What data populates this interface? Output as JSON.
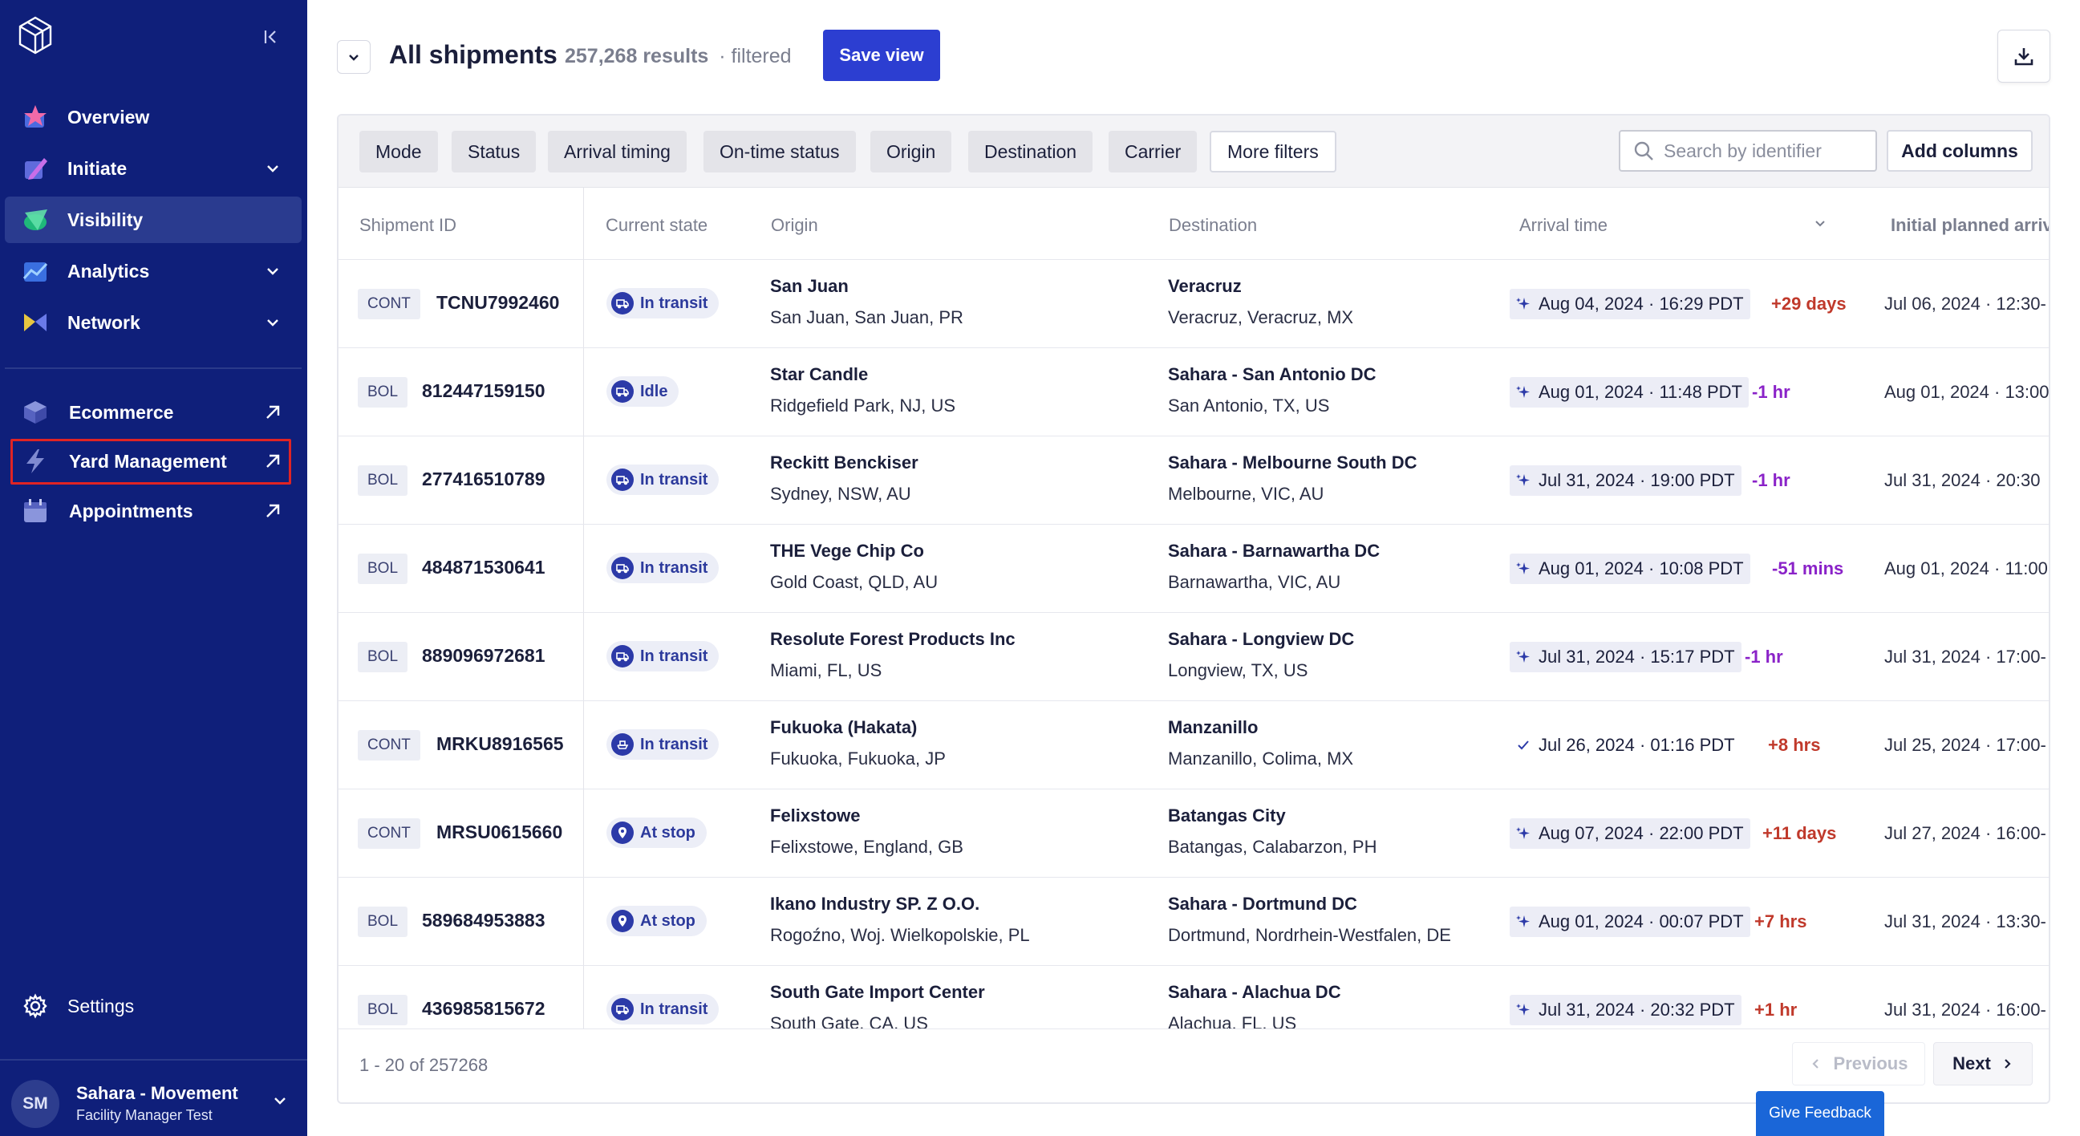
{
  "sidebar": {
    "items": [
      {
        "label": "Overview",
        "icon": "overview-icon"
      },
      {
        "label": "Initiate",
        "icon": "initiate-icon"
      },
      {
        "label": "Visibility",
        "icon": "visibility-icon"
      },
      {
        "label": "Analytics",
        "icon": "analytics-icon"
      },
      {
        "label": "Network",
        "icon": "network-icon"
      }
    ],
    "external_items": [
      {
        "label": "Ecommerce",
        "icon": "ecommerce-icon"
      },
      {
        "label": "Yard Management",
        "icon": "lightning-icon"
      },
      {
        "label": "Appointments",
        "icon": "calendar-icon"
      }
    ],
    "settings_label": "Settings",
    "user": {
      "initials": "SM",
      "name": "Sahara - Movement",
      "role": "Facility Manager Test"
    }
  },
  "header": {
    "title": "All shipments",
    "results_count": "257,268 results",
    "filtered_label": "· filtered",
    "save_view_label": "Save view"
  },
  "filters": {
    "chips": [
      "Mode",
      "Status",
      "Arrival timing",
      "On-time status",
      "Origin",
      "Destination",
      "Carrier"
    ],
    "more_filters": "More filters",
    "search_placeholder": "Search by identifier",
    "add_columns": "Add columns"
  },
  "table": {
    "columns": [
      "Shipment ID",
      "Current state",
      "Origin",
      "Destination",
      "Arrival time",
      "Initial planned arriv"
    ],
    "rows": [
      {
        "type": "CONT",
        "id": "TCNU7992460",
        "state": "In transit",
        "state_icon": "truck-icon",
        "origin_name": "San Juan",
        "origin_loc": "San Juan, San Juan, PR",
        "dest_name": "Veracruz",
        "dest_loc": "Veracruz, Veracruz, MX",
        "arrival": "Aug 04, 2024 · 16:29 PDT",
        "arrival_icon": "sparkle-icon",
        "delta": "+29 days",
        "delta_color": "#c0392b",
        "planned": "Jul 06, 2024 · 12:30-"
      },
      {
        "type": "BOL",
        "id": "812447159150",
        "state": "Idle",
        "state_icon": "truck-icon",
        "origin_name": "Star Candle",
        "origin_loc": "Ridgefield Park, NJ, US",
        "dest_name": "Sahara - San Antonio DC",
        "dest_loc": "San Antonio, TX, US",
        "arrival": "Aug 01, 2024 · 11:48 PDT",
        "arrival_icon": "sparkle-icon",
        "delta": "-1 hr",
        "delta_color": "#8a22c8",
        "planned": "Aug 01, 2024 · 13:00"
      },
      {
        "type": "BOL",
        "id": "277416510789",
        "state": "In transit",
        "state_icon": "truck-icon",
        "origin_name": "Reckitt Benckiser",
        "origin_loc": "Sydney, NSW, AU",
        "dest_name": "Sahara - Melbourne South DC",
        "dest_loc": "Melbourne, VIC, AU",
        "arrival": "Jul 31, 2024 · 19:00 PDT",
        "arrival_icon": "sparkle-icon",
        "delta": "-1 hr",
        "delta_color": "#8a22c8",
        "planned": "Jul 31, 2024 · 20:30"
      },
      {
        "type": "BOL",
        "id": "484871530641",
        "state": "In transit",
        "state_icon": "truck-icon",
        "origin_name": "THE Vege Chip Co",
        "origin_loc": "Gold Coast, QLD, AU",
        "dest_name": "Sahara - Barnawartha DC",
        "dest_loc": "Barnawartha, VIC, AU",
        "arrival": "Aug 01, 2024 · 10:08 PDT",
        "arrival_icon": "sparkle-icon",
        "delta": "-51 mins",
        "delta_color": "#8a22c8",
        "planned": "Aug 01, 2024 · 11:00"
      },
      {
        "type": "BOL",
        "id": "889096972681",
        "state": "In transit",
        "state_icon": "truck-icon",
        "origin_name": "Resolute Forest Products Inc",
        "origin_loc": "Miami, FL, US",
        "dest_name": "Sahara - Longview DC",
        "dest_loc": "Longview, TX, US",
        "arrival": "Jul 31, 2024 · 15:17 PDT",
        "arrival_icon": "sparkle-icon",
        "delta": "-1 hr",
        "delta_color": "#8a22c8",
        "planned": "Jul 31, 2024 · 17:00-"
      },
      {
        "type": "CONT",
        "id": "MRKU8916565",
        "state": "In transit",
        "state_icon": "ship-icon",
        "origin_name": "Fukuoka (Hakata)",
        "origin_loc": "Fukuoka, Fukuoka, JP",
        "dest_name": "Manzanillo",
        "dest_loc": "Manzanillo, Colima, MX",
        "arrival": "Jul 26, 2024 · 01:16 PDT",
        "arrival_icon": "check-icon",
        "delta": "+8 hrs",
        "delta_color": "#c0392b",
        "planned": "Jul 25, 2024 · 17:00-"
      },
      {
        "type": "CONT",
        "id": "MRSU0615660",
        "state": "At stop",
        "state_icon": "pin-icon",
        "origin_name": "Felixstowe",
        "origin_loc": "Felixstowe, England, GB",
        "dest_name": "Batangas City",
        "dest_loc": "Batangas, Calabarzon, PH",
        "arrival": "Aug 07, 2024 · 22:00 PDT",
        "arrival_icon": "sparkle-icon",
        "delta": "+11 days",
        "delta_color": "#c0392b",
        "planned": "Jul 27, 2024 · 16:00-"
      },
      {
        "type": "BOL",
        "id": "589684953883",
        "state": "At stop",
        "state_icon": "pin-icon",
        "origin_name": "Ikano Industry SP. Z O.O.",
        "origin_loc": "Rogoźno, Woj. Wielkopolskie, PL",
        "dest_name": "Sahara - Dortmund DC",
        "dest_loc": "Dortmund, Nordrhein-Westfalen, DE",
        "arrival": "Aug 01, 2024 · 00:07 PDT",
        "arrival_icon": "sparkle-icon",
        "delta": "+7 hrs",
        "delta_color": "#c0392b",
        "planned": "Jul 31, 2024 · 13:30-"
      },
      {
        "type": "BOL",
        "id": "436985815672",
        "state": "In transit",
        "state_icon": "truck-icon",
        "origin_name": "South Gate Import Center",
        "origin_loc": "South Gate, CA, US",
        "dest_name": "Sahara - Alachua DC",
        "dest_loc": "Alachua, FL, US",
        "arrival": "Jul 31, 2024 · 20:32 PDT",
        "arrival_icon": "sparkle-icon",
        "delta": "+1 hr",
        "delta_color": "#c0392b",
        "planned": "Jul 31, 2024 · 16:00-"
      }
    ]
  },
  "pagination": {
    "range": "1 - 20 of 257268",
    "previous": "Previous",
    "next": "Next"
  },
  "feedback_label": "Give Feedback"
}
